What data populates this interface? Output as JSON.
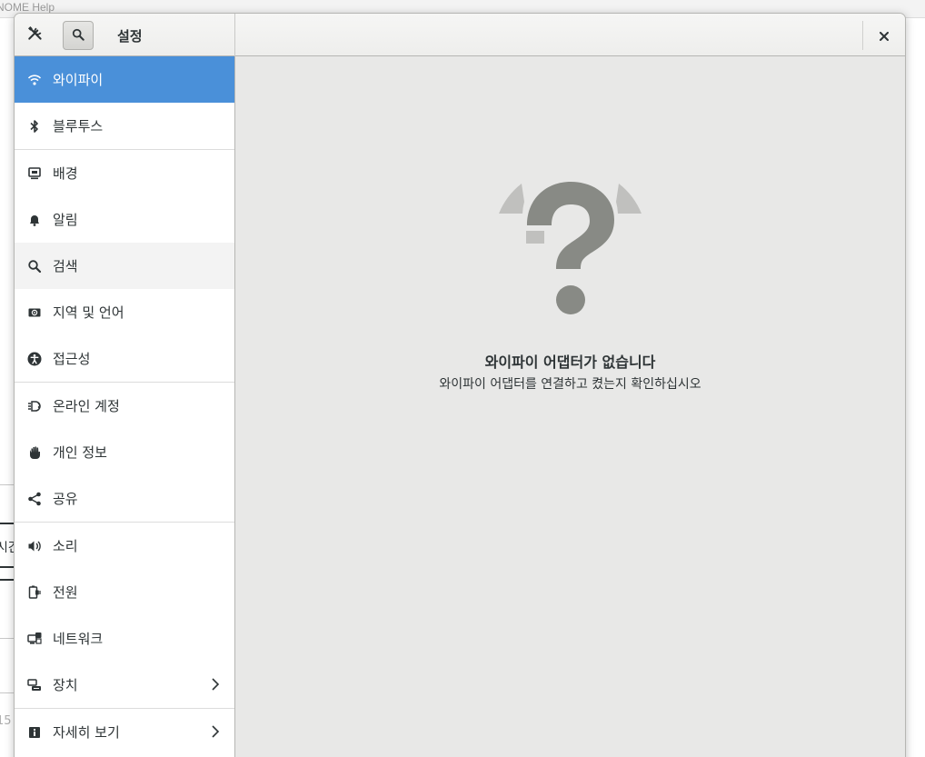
{
  "background_window": {
    "title": "NOME Help",
    "side_text_a": "시간",
    "side_text_b": "15"
  },
  "header": {
    "title": "설정",
    "tools_icon": "tools-icon",
    "search_icon": "search-icon",
    "close_icon": "close-icon"
  },
  "sidebar": {
    "items": [
      {
        "label": "와이파이",
        "icon": "wifi-icon"
      },
      {
        "label": "블루투스",
        "icon": "bluetooth-icon"
      },
      {
        "label": "배경",
        "icon": "background-icon"
      },
      {
        "label": "알림",
        "icon": "bell-icon"
      },
      {
        "label": "검색",
        "icon": "search-icon"
      },
      {
        "label": "지역 및 언어",
        "icon": "region-icon"
      },
      {
        "label": "접근성",
        "icon": "accessibility-icon"
      },
      {
        "label": "온라인 계정",
        "icon": "online-accounts-icon"
      },
      {
        "label": "개인 정보",
        "icon": "privacy-hand-icon"
      },
      {
        "label": "공유",
        "icon": "share-icon"
      },
      {
        "label": "소리",
        "icon": "speaker-icon"
      },
      {
        "label": "전원",
        "icon": "power-plug-icon"
      },
      {
        "label": "네트워크",
        "icon": "network-icon"
      },
      {
        "label": "장치",
        "icon": "devices-icon"
      },
      {
        "label": "자세히 보기",
        "icon": "info-icon"
      }
    ],
    "selected": "와이파이"
  },
  "main": {
    "empty_icon": "question-mark-icon",
    "title": "와이파이 어댑터가 없습니다",
    "description": "와이파이 어댑터를 연결하고 켰는지 확인하십시오"
  },
  "colors": {
    "accent": "#4a90d9",
    "content_bg": "#e8e8e7",
    "icon_gray": "#888a85"
  }
}
